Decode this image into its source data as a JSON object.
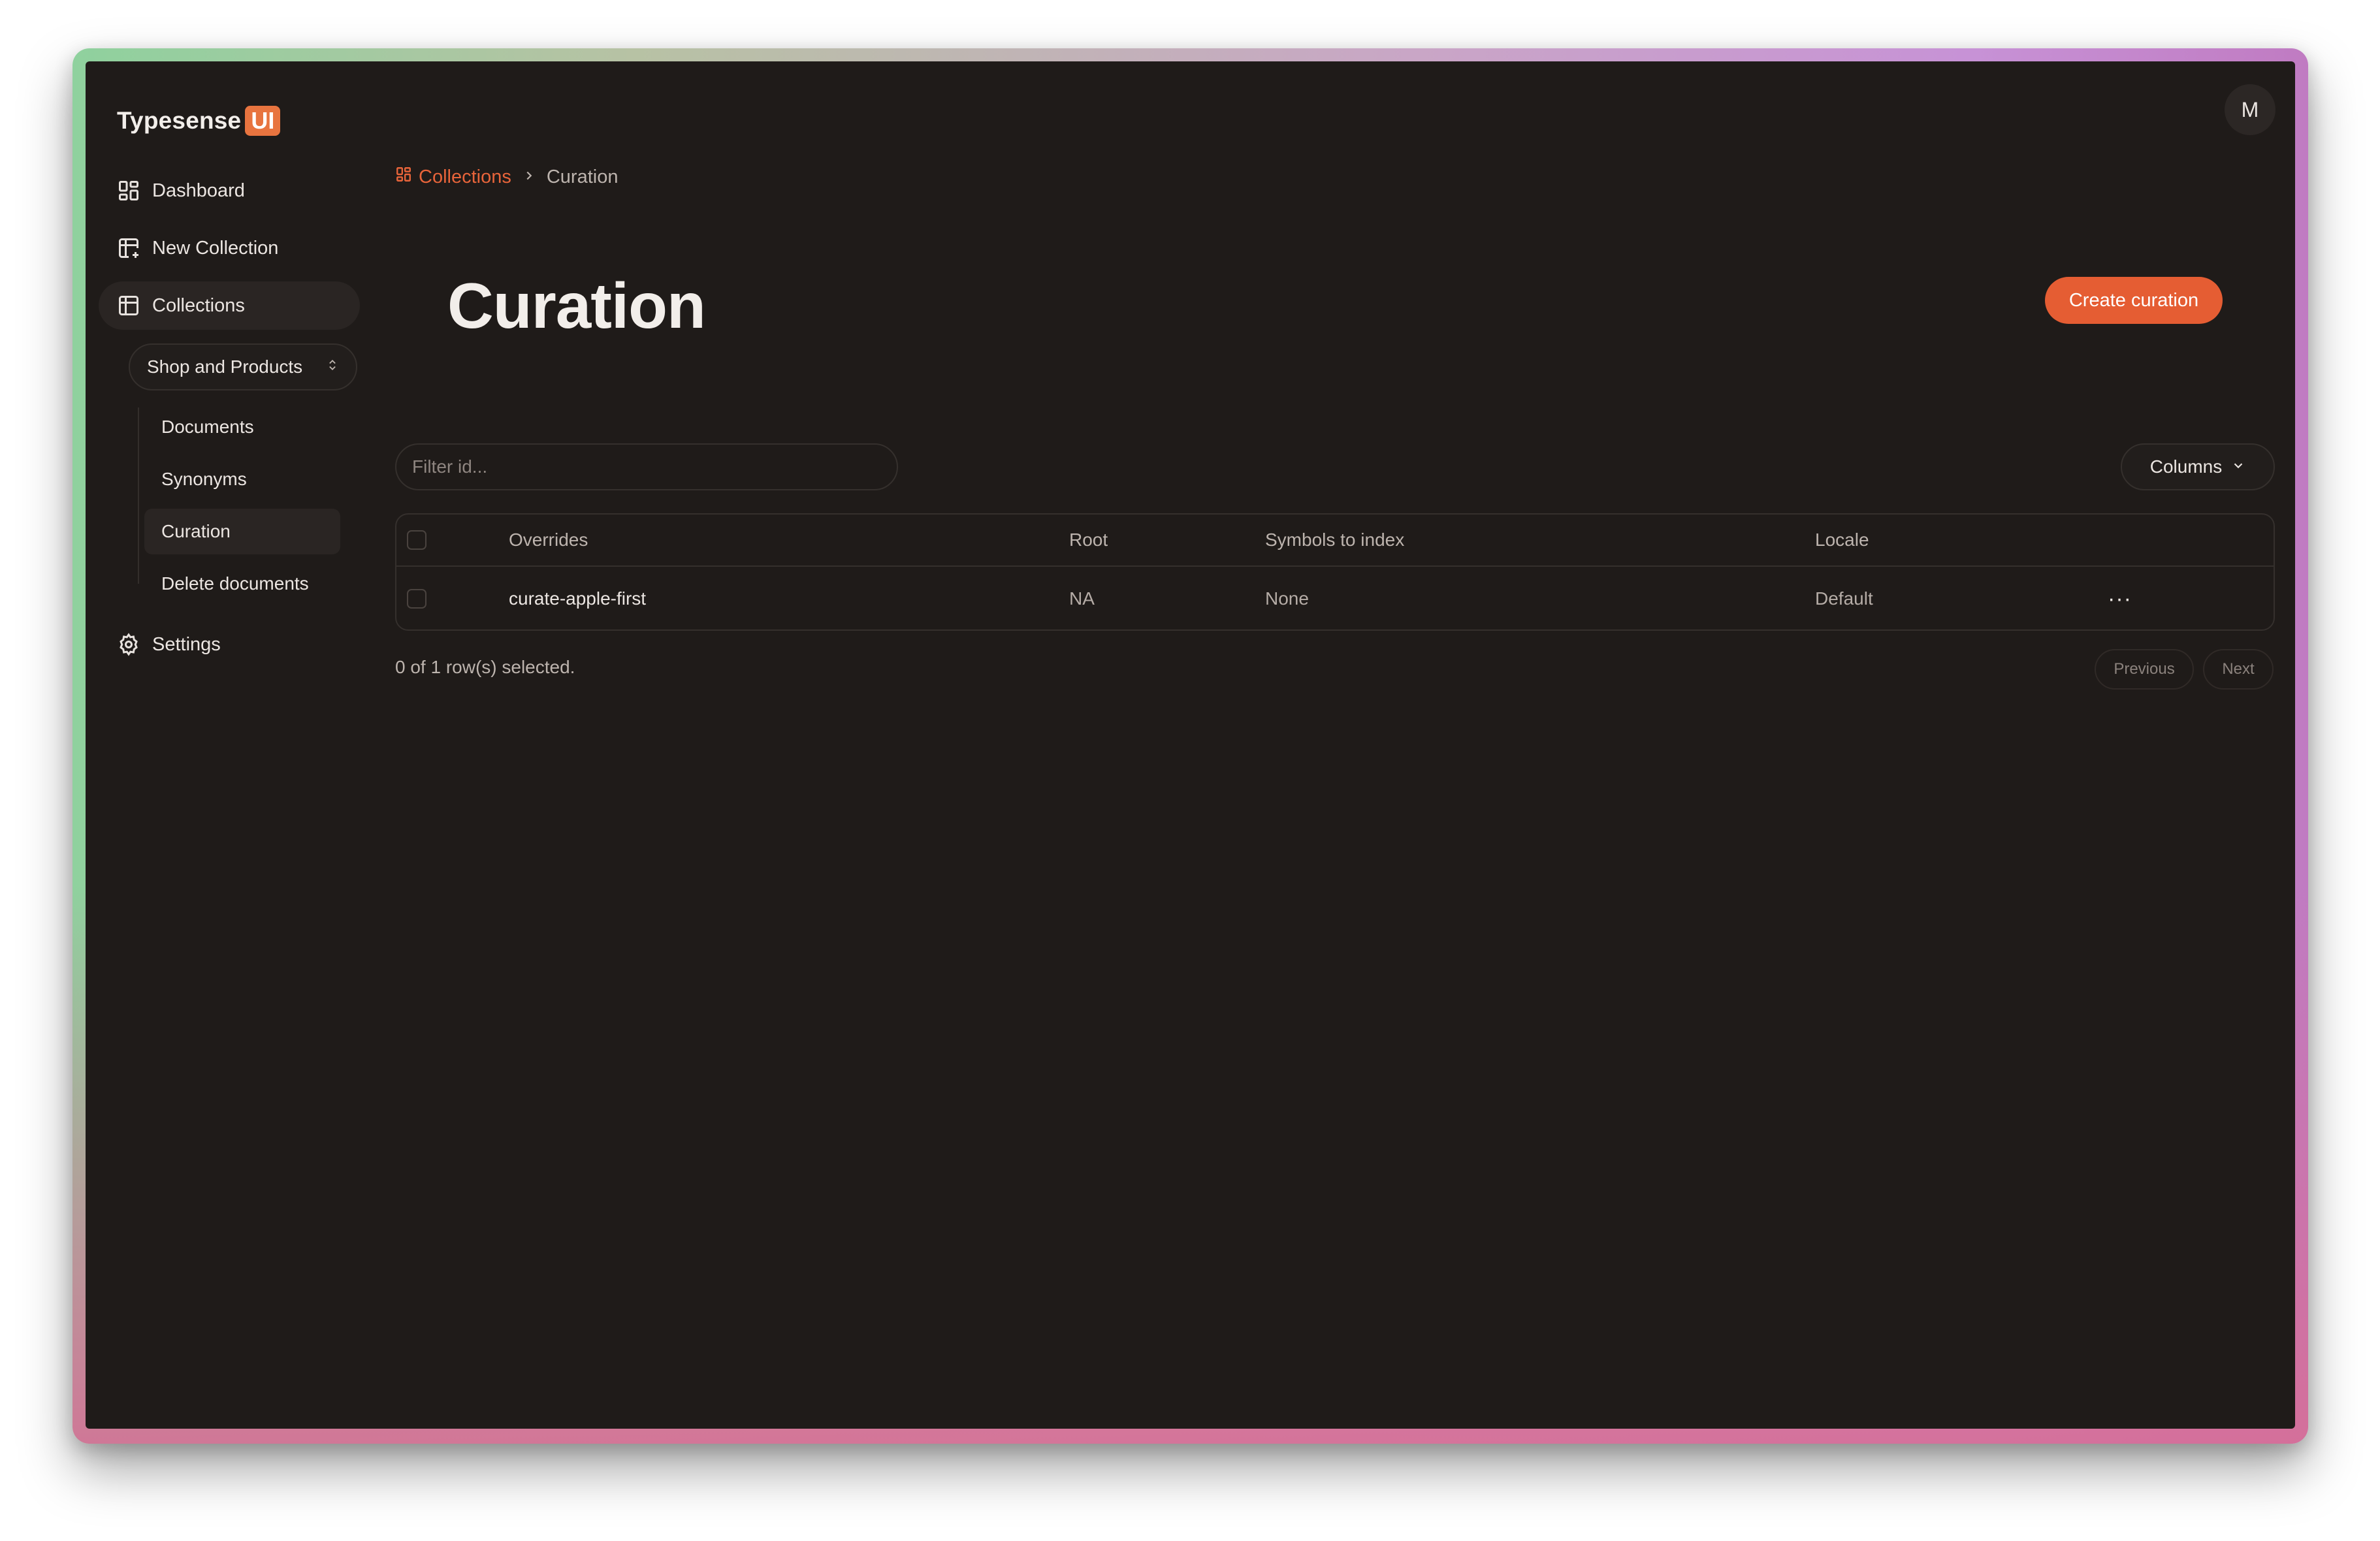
{
  "app": {
    "brand_name": "Typesense",
    "brand_badge": "UI",
    "avatar_initial": "M",
    "accent_color": "#e55d33"
  },
  "sidebar": {
    "items": [
      {
        "label": "Dashboard",
        "icon": "dashboard-icon"
      },
      {
        "label": "New Collection",
        "icon": "table-plus-icon"
      },
      {
        "label": "Collections",
        "icon": "table-icon",
        "active": true
      },
      {
        "label": "Settings",
        "icon": "gear-icon"
      }
    ],
    "collection_select": {
      "value": "Shop and Products",
      "icon": "chevron-up-down-icon"
    },
    "sub_items": [
      {
        "label": "Documents"
      },
      {
        "label": "Synonyms"
      },
      {
        "label": "Curation",
        "active": true
      },
      {
        "label": "Delete documents"
      }
    ]
  },
  "breadcrumb": {
    "link_label": "Collections",
    "current": "Curation"
  },
  "page": {
    "title": "Curation",
    "create_button": "Create curation"
  },
  "toolbar": {
    "filter_placeholder": "Filter id...",
    "filter_value": "",
    "columns_label": "Columns"
  },
  "table": {
    "headers": [
      "Overrides",
      "Root",
      "Symbols to index",
      "Locale"
    ],
    "rows": [
      {
        "overrides": "curate-apple-first",
        "root": "NA",
        "symbols": "None",
        "locale": "Default",
        "actions": "···"
      }
    ]
  },
  "footer": {
    "selection_text": "0 of 1 row(s) selected.",
    "previous_label": "Previous",
    "next_label": "Next"
  }
}
